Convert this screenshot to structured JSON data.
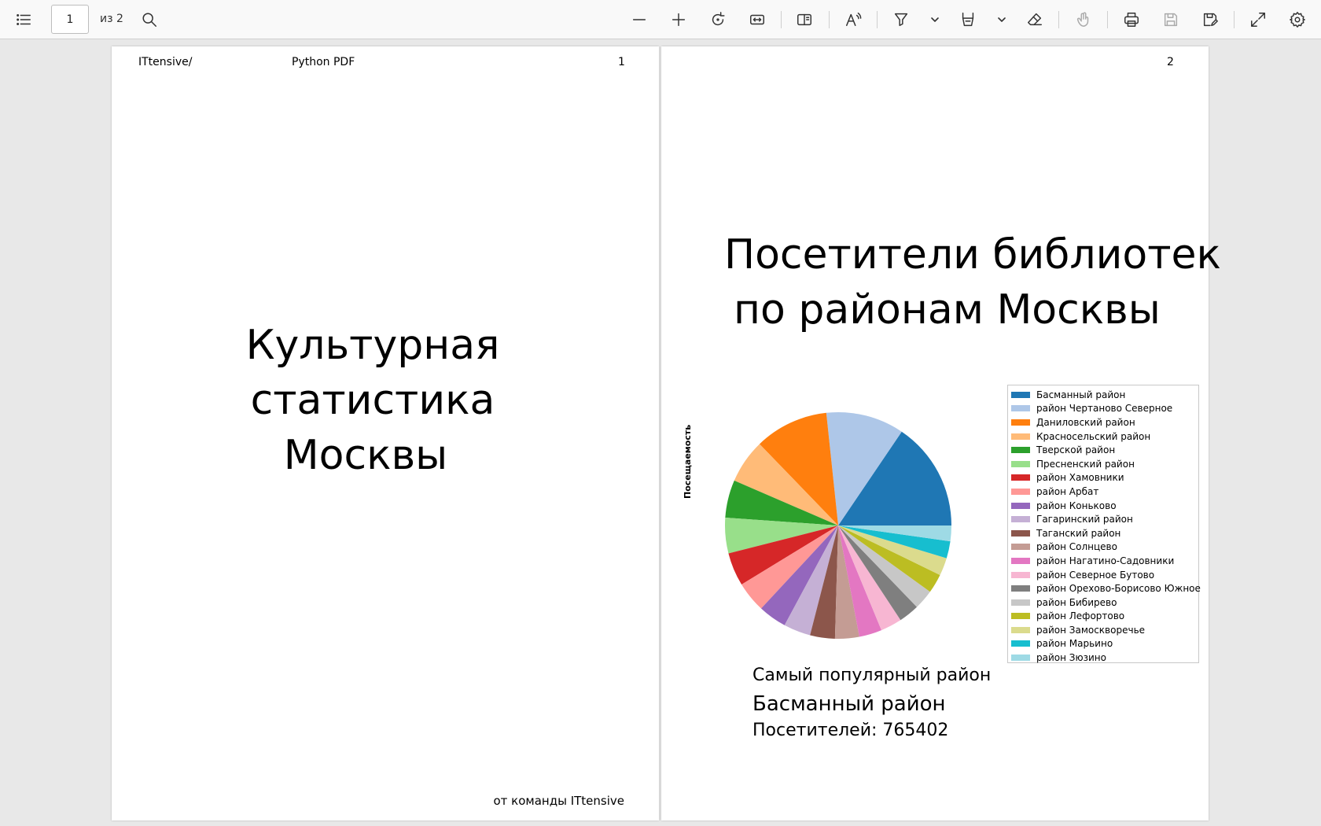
{
  "toolbar": {
    "current_page": "1",
    "page_count": "из 2",
    "icons": [
      "list-icon",
      "search-icon",
      "zoom-out-icon",
      "zoom-in-icon",
      "rotate-icon",
      "fit-width-icon",
      "page-view-icon",
      "read-aloud-icon",
      "highlight-icon",
      "draw-icon",
      "eraser-icon",
      "touch-icon",
      "print-icon",
      "save-icon",
      "save-as-icon",
      "fullscreen-icon",
      "settings-icon"
    ]
  },
  "page1": {
    "header_left": "ITtensive/",
    "header_mid": "Python PDF",
    "page_number": "1",
    "title_lines": [
      "Культурная",
      "статистика",
      "Москвы"
    ],
    "footer": "от команды ITtensive"
  },
  "page2": {
    "page_number": "2",
    "title_lines": [
      "Посетители библиотек",
      "по районам Москвы"
    ],
    "ylabel": "Посещаемость",
    "summary_label": "Самый популярный район",
    "summary_district": "Басманный район",
    "summary_visitors": "Посетителей: 765402"
  },
  "chart_data": {
    "type": "pie",
    "ylabel": "Посещаемость",
    "legend_position": "right",
    "labels": [
      "Басманный район",
      "район Чертаново Северное",
      "Даниловский район",
      "Красносельский район",
      "Тверской район",
      "Пресненский район",
      "район Хамовники",
      "район Арбат",
      "район Коньково",
      "Гагаринский район",
      "Таганский район",
      "район Солнцево",
      "район Нагатино-Садовники",
      "район Северное Бутово",
      "район Орехово-Борисово Южное",
      "район Бибирево",
      "район Лефортово",
      "район Замоскворечье",
      "район Марьино",
      "район Зюзино"
    ],
    "values": [
      765402,
      550000,
      520000,
      310000,
      265000,
      250000,
      235000,
      215000,
      200000,
      190000,
      175000,
      170000,
      160000,
      150000,
      145000,
      140000,
      135000,
      125000,
      120000,
      110000
    ],
    "colors": [
      "#1f77b4",
      "#aec7e8",
      "#ff7f0e",
      "#ffbb78",
      "#2ca02c",
      "#98df8a",
      "#d62728",
      "#ff9896",
      "#9467bd",
      "#c5b0d5",
      "#8c564b",
      "#c49c94",
      "#e377c2",
      "#f7b6d2",
      "#7f7f7f",
      "#c7c7c7",
      "#bcbd22",
      "#dbdb8d",
      "#17becf",
      "#9edae5"
    ]
  }
}
